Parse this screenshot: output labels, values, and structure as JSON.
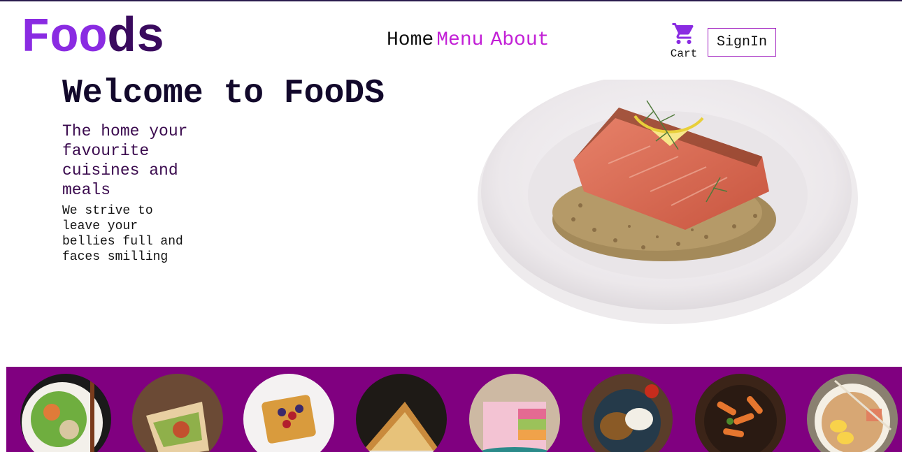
{
  "header": {
    "logo_part1": "Foo",
    "logo_part2": "ds",
    "nav": {
      "home": "Home",
      "menu": "Menu",
      "about": "About"
    },
    "cart_label": "Cart",
    "signin_label": "SignIn"
  },
  "hero": {
    "title": "Welcome to FooDS",
    "subtitle": "The home your favourite cuisines and meals",
    "description": "We strive to leave your bellies full and faces smilling"
  },
  "colors": {
    "accent": "#8a2be2",
    "dark_purple": "#3a0a5e",
    "nav_link": "#c21fd6",
    "strip_background": "#800080"
  },
  "dishes": [
    {
      "icon": "salad-bowl-image"
    },
    {
      "icon": "wrap-image"
    },
    {
      "icon": "waffle-image"
    },
    {
      "icon": "sandwich-image"
    },
    {
      "icon": "cake-image"
    },
    {
      "icon": "curry-rice-image"
    },
    {
      "icon": "pasta-image"
    },
    {
      "icon": "ramen-image"
    }
  ]
}
